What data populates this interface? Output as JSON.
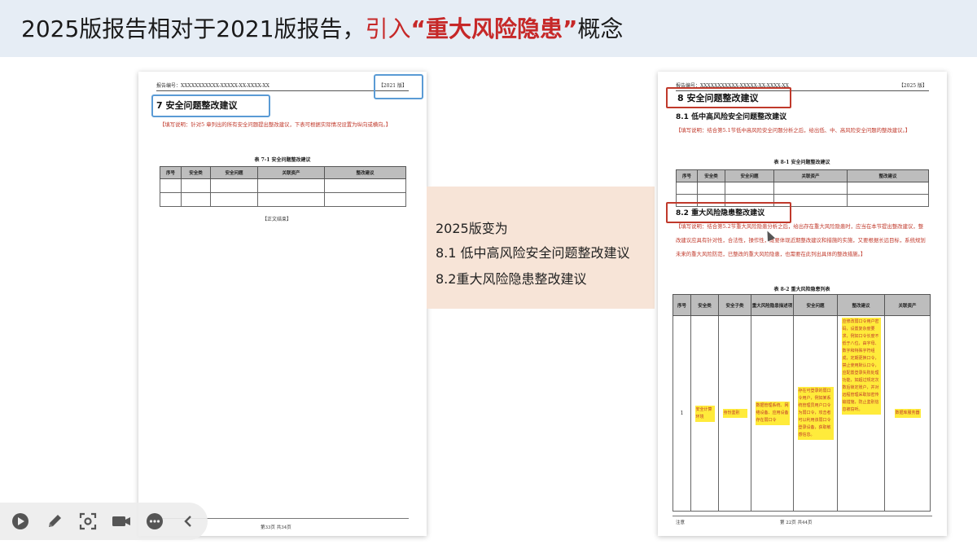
{
  "slide": {
    "title_prefix": "2025版报告相对于2021版报告，",
    "title_accent_prefix": "引入",
    "title_accent_quoted": "“重大风险隐患”",
    "title_suffix": "概念"
  },
  "left_page": {
    "doc_code": "报告编号：XXXXXXXXXXX-XXXXX-XX-XXXX-XX",
    "doc_version": "【2021 版】",
    "section_title": "7   安全问题整改建议",
    "note": "【填写说明：针对5 章列出的所有安全问题提出整改建议，下表可根据实际情况设置为纵向或横向。】",
    "table_caption": "表 7-1  安全问题整改建议",
    "table_headers": [
      "序号",
      "安全类",
      "安全问题",
      "关联资产",
      "整改建议"
    ],
    "body_end": "【正文结束】",
    "footer_page": "第33页 共34页"
  },
  "center": {
    "line1": "2025版变为",
    "line2": "8.1 低中高风险安全问题整改建议",
    "line3": "8.2重大风险隐患整改建议"
  },
  "right_page": {
    "doc_code": "报告编号：XXXXXXXXXXX-XXXXX-XX-XXXX-XX",
    "doc_version": "【2025 版】",
    "section_title": "8   安全问题整改建议",
    "sub1_title": "8.1   低中高风险安全问题整改建议",
    "note1": "【填写说明：结合第5.1节低中高风险安全问题分析之后，给出低、中、高风险安全问题的整改建议。】",
    "table1_caption": "表 8-1  安全问题整改建议",
    "table1_headers": [
      "序号",
      "安全类",
      "安全问题",
      "关联资产",
      "整改建议"
    ],
    "sub2_title": "8.2   重大风险隐患整改建议",
    "note2": "【填写说明：结合第5.2节重大风险隐患分析之后，给出存在重大风险隐患时，应当在本节提出整改建议，整改建议应具有针对性，合法性，操作性，既要体现近期整改建议和措施的实施，又要根据长远目标，系统规划未来的重大风险防范，已整改的重大风险隐患，也需要在此列出具体的整改措施。】",
    "table2_caption": "表 8-2  重大风险隐患列表",
    "table2_headers": [
      "序号",
      "安全类",
      "安全子类",
      "重大风险隐患描述项",
      "安全问题",
      "整改建议",
      "关联资产"
    ],
    "table2_row": {
      "no": "1",
      "cls": "安全计算环境",
      "subcls": "身份鉴别",
      "desc": "数据管理系统、网络设备、应用设备存在弱口令",
      "issue": "存在可登录的弱口令用户，例如某系统管理员用户口令为弱口令，攻击者可以利用该弱口令登录设备，获取敏感信息。",
      "advice": "应修改弱口令用户密码，设置复杂度要求，例如口令长度不低于八位，由字母、数字和特殊字符组成，定期更换口令，禁止使用默认口令，应配置登录失败处理功能，如超过规定次数后锁定账户，并对远程管理采取加密传输措施，防止鉴别信息被窃听。",
      "asset": "数据库服务器"
    },
    "footer_left": "注意",
    "footer_page": "第 22页 共44页"
  },
  "toolbar": {
    "buttons": [
      "play-icon",
      "pen-icon",
      "screenshot-icon",
      "camera-icon",
      "more-icon",
      "back-icon"
    ]
  }
}
